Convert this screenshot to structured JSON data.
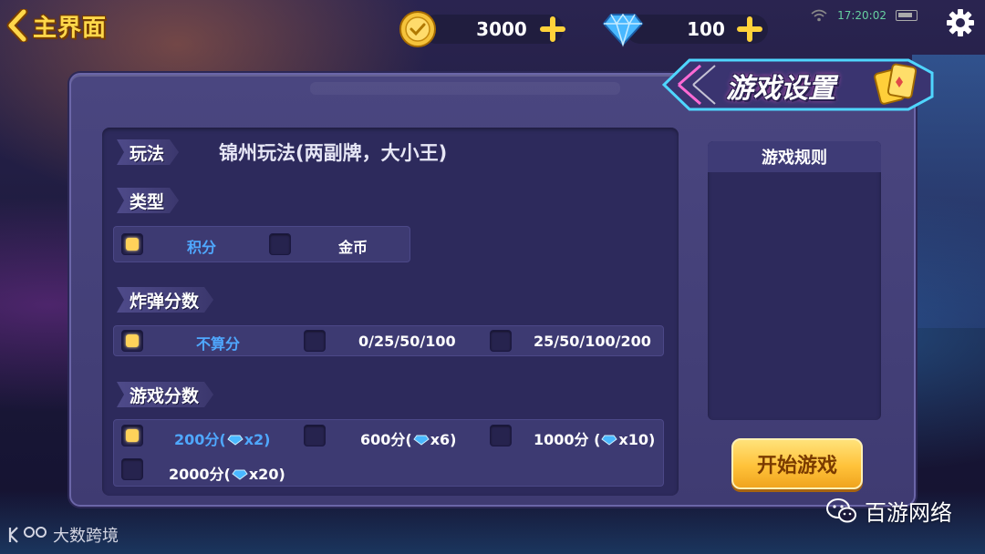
{
  "top": {
    "home_label": "主界面",
    "coins": "3000",
    "gems": "100",
    "time": "17:20:02"
  },
  "panel": {
    "title": "游戏设置",
    "play_tag": "玩法",
    "play_mode": "锦州玩法(两副牌，大小王)",
    "type_tag": "类型",
    "type_options": [
      {
        "label": "积分",
        "checked": true
      },
      {
        "label": "金币",
        "checked": false
      }
    ],
    "bomb_tag": "炸弹分数",
    "bomb_options": [
      {
        "label": "不算分",
        "checked": true
      },
      {
        "label": "0/25/50/100",
        "checked": false
      },
      {
        "label": "25/50/100/200",
        "checked": false
      }
    ],
    "score_tag": "游戏分数",
    "score_options": [
      {
        "label_pre": "200分(",
        "label_post": "x2)",
        "checked": true
      },
      {
        "label_pre": "600分(",
        "label_post": "x6)",
        "checked": false
      },
      {
        "label_pre": "1000分 (",
        "label_post": "x10)",
        "checked": false
      },
      {
        "label_pre": "2000分(",
        "label_post": "x20)",
        "checked": false
      }
    ],
    "rules_title": "游戏规则",
    "start_label": "开始游戏"
  },
  "watermarks": {
    "left": "大数跨境",
    "right": "百游网络"
  },
  "colors": {
    "selected_text": "#4fa8ff",
    "checkbox_on": "#ffd25a",
    "start_button": "#ffc23a"
  }
}
